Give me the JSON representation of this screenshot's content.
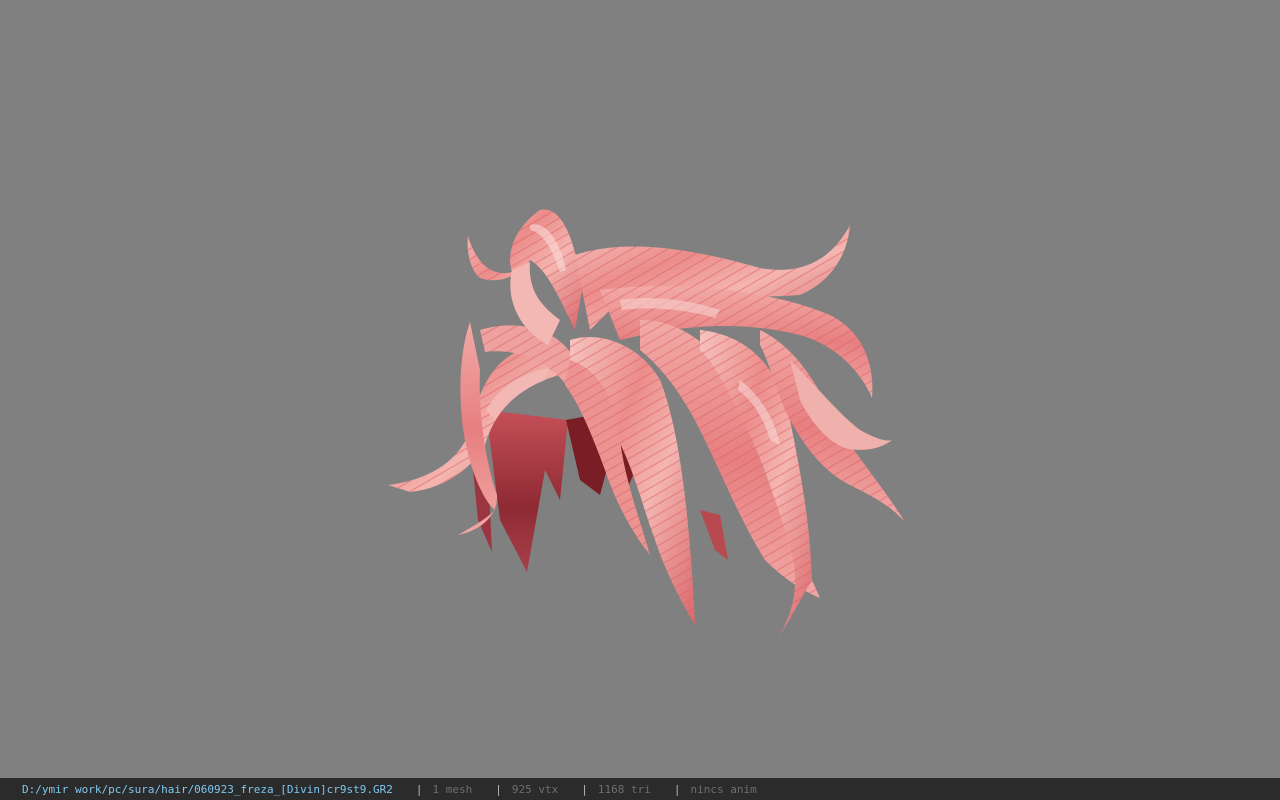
{
  "viewer": {
    "background_color": "#808080",
    "model_colors": {
      "light": "#f3b8b4",
      "mid": "#e87b7b",
      "dark": "#b84a4f",
      "shadow": "#7a1e26"
    }
  },
  "statusbar": {
    "file_path": "D:/ymir work/pc/sura/hair/060923_freza_[Divin]cr9st9.GR2",
    "separator": "|",
    "mesh_count": "1 mesh",
    "vertex_count": "925 vtx",
    "triangle_count": "1168 tri",
    "anim_status": "nincs anim",
    "path_color": "#7ec7f0",
    "stat_color": "#6e6e6e"
  }
}
